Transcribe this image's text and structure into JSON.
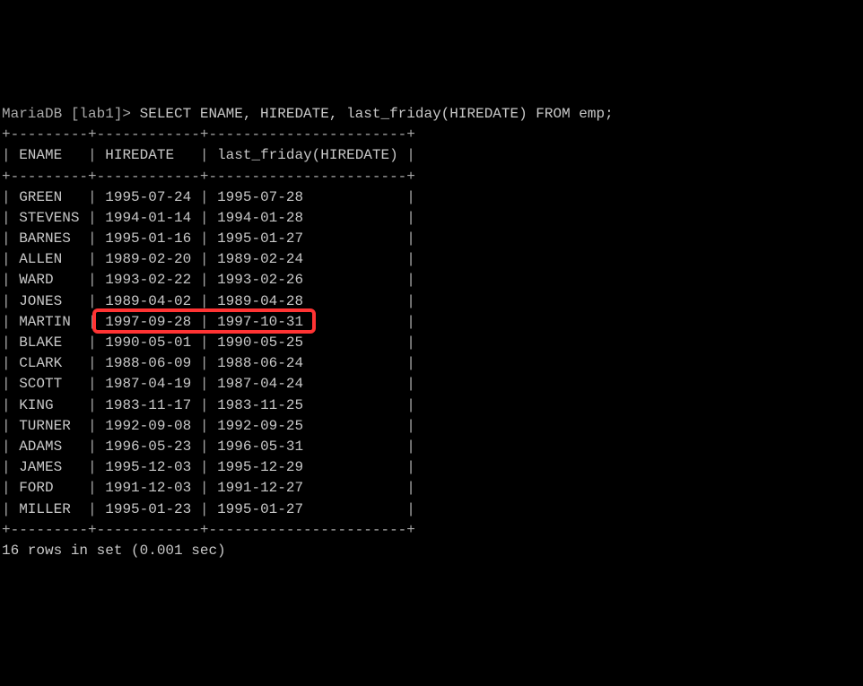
{
  "prompt": "MariaDB [lab1]> ",
  "command": "SELECT ENAME, HIREDATE, last_friday(HIREDATE) FROM emp;",
  "top_border": "+---------+------------+-----------------------+",
  "header_sep": "+---------+------------+-----------------------+",
  "bottom_border": "+---------+------------+-----------------------+",
  "headers": {
    "col1": "ENAME",
    "col2": "HIREDATE",
    "col3": "last_friday(HIREDATE)"
  },
  "rows": [
    {
      "ename": "GREEN",
      "hiredate": "1995-07-24",
      "lastfri": "1995-07-28"
    },
    {
      "ename": "STEVENS",
      "hiredate": "1994-01-14",
      "lastfri": "1994-01-28"
    },
    {
      "ename": "BARNES",
      "hiredate": "1995-01-16",
      "lastfri": "1995-01-27"
    },
    {
      "ename": "ALLEN",
      "hiredate": "1989-02-20",
      "lastfri": "1989-02-24"
    },
    {
      "ename": "WARD",
      "hiredate": "1993-02-22",
      "lastfri": "1993-02-26"
    },
    {
      "ename": "JONES",
      "hiredate": "1989-04-02",
      "lastfri": "1989-04-28"
    },
    {
      "ename": "MARTIN",
      "hiredate": "1997-09-28",
      "lastfri": "1997-10-31"
    },
    {
      "ename": "BLAKE",
      "hiredate": "1990-05-01",
      "lastfri": "1990-05-25"
    },
    {
      "ename": "CLARK",
      "hiredate": "1988-06-09",
      "lastfri": "1988-06-24"
    },
    {
      "ename": "SCOTT",
      "hiredate": "1987-04-19",
      "lastfri": "1987-04-24"
    },
    {
      "ename": "KING",
      "hiredate": "1983-11-17",
      "lastfri": "1983-11-25"
    },
    {
      "ename": "TURNER",
      "hiredate": "1992-09-08",
      "lastfri": "1992-09-25"
    },
    {
      "ename": "ADAMS",
      "hiredate": "1996-05-23",
      "lastfri": "1996-05-31"
    },
    {
      "ename": "JAMES",
      "hiredate": "1995-12-03",
      "lastfri": "1995-12-29"
    },
    {
      "ename": "FORD",
      "hiredate": "1991-12-03",
      "lastfri": "1991-12-27"
    },
    {
      "ename": "MILLER",
      "hiredate": "1995-01-23",
      "lastfri": "1995-01-27"
    }
  ],
  "status": "16 rows in set (0.001 sec)",
  "highlight_row_index": 6
}
